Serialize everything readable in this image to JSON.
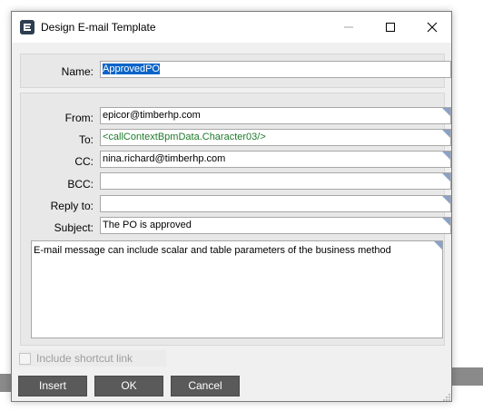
{
  "window": {
    "title": "Design E-mail Template",
    "icon": "epicor-e-icon",
    "controls": [
      "minimize-icon",
      "maximize-icon",
      "close-icon"
    ]
  },
  "name_section": {
    "label": "Name:",
    "value": "ApprovedPO",
    "value_selected": true
  },
  "fields": {
    "from": {
      "label": "From:",
      "value": "epicor@timberhp.com"
    },
    "to": {
      "label": "To:",
      "value": "<callContextBpmData.Character03/>"
    },
    "cc": {
      "label": "CC:",
      "value": "nina.richard@timberhp.com"
    },
    "bcc": {
      "label": "BCC:",
      "value": ""
    },
    "reply_to": {
      "label": "Reply to:",
      "value": ""
    },
    "subject": {
      "label": "Subject:",
      "value": "The PO is approved"
    }
  },
  "message": {
    "value": "E-mail message can include scalar and table parameters of the business method"
  },
  "shortcut": {
    "label": "Include shortcut link",
    "checked": false,
    "enabled": false
  },
  "buttons": {
    "insert": "Insert",
    "ok": "OK",
    "cancel": "Cancel"
  },
  "colors": {
    "accent_selection": "#0a64c8",
    "button_bg": "#5a5a5a",
    "tag_text": "#1d7a2a",
    "field_corner": "#8aa2c4"
  }
}
